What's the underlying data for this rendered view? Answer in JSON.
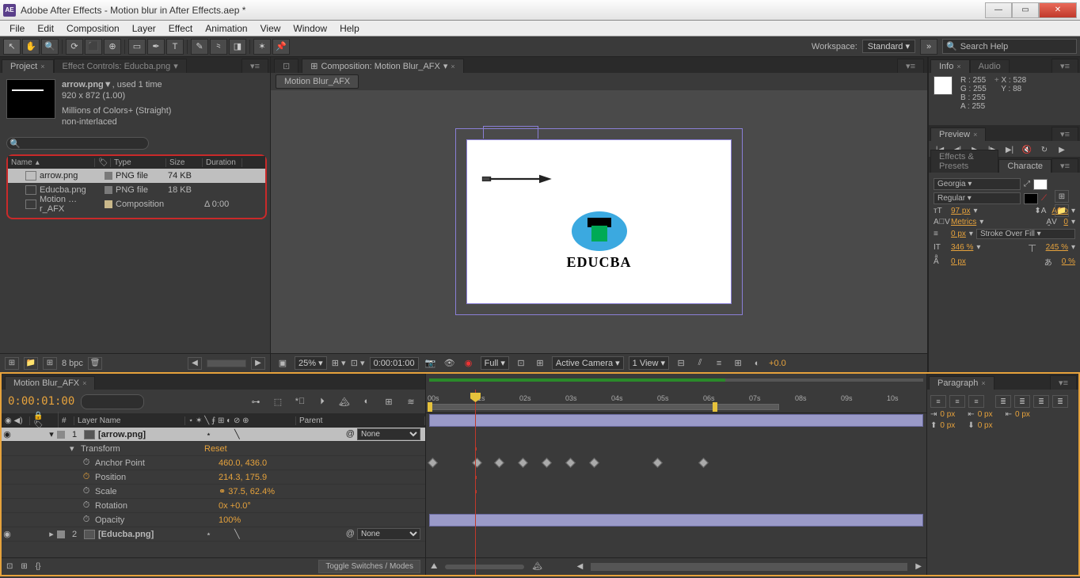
{
  "titlebar": {
    "app_icon": "AE",
    "title": "Adobe After Effects - Motion blur in After Effects.aep *"
  },
  "menubar": [
    "File",
    "Edit",
    "Composition",
    "Layer",
    "Effect",
    "Animation",
    "View",
    "Window",
    "Help"
  ],
  "toolbar": {
    "tools": [
      "⬚",
      "✋",
      "🔍",
      "↻",
      "⬛",
      "⚬",
      "✎",
      "✒",
      "✶",
      "T",
      "✎",
      "⌫",
      "◧",
      "⊞",
      "★",
      "✋"
    ],
    "workspace_label": "Workspace:",
    "workspace_value": "Standard",
    "search_placeholder": "Search Help"
  },
  "project": {
    "tab_label": "Project",
    "effect_controls_tab": "Effect Controls: Educba.png",
    "asset_name": "arrow.png▼",
    "asset_usage": ", used 1 time",
    "asset_dims": "920 x 872 (1.00)",
    "asset_colors": "Millions of Colors+ (Straight)",
    "asset_interlace": "non-interlaced",
    "cols": {
      "name": "Name",
      "label": "",
      "type": "Type",
      "size": "Size",
      "duration": "Duration"
    },
    "items": [
      {
        "name": "arrow.png",
        "type": "PNG file",
        "size": "74 KB",
        "dur": "",
        "selected": true
      },
      {
        "name": "Educba.png",
        "type": "PNG file",
        "size": "18 KB",
        "dur": "",
        "selected": false
      },
      {
        "name": "Motion …r_AFX",
        "type": "Composition",
        "size": "",
        "dur": "Δ 0:00",
        "selected": false
      }
    ],
    "bpc": "8 bpc"
  },
  "composition": {
    "tab_label": "Composition: Motion Blur_AFX",
    "subtab": "Motion Blur_AFX",
    "logo_text": "EDUCBA",
    "footer": {
      "zoom": "25%",
      "timecode": "0:00:01:00",
      "res": "Full",
      "camera": "Active Camera",
      "views": "1 View",
      "exposure": "+0.0"
    }
  },
  "info": {
    "tab_label": "Info",
    "audio_tab": "Audio",
    "r": "R : 255",
    "g": "G : 255",
    "b": "B : 255",
    "a": "A : 255",
    "x": "X : 528",
    "y": "Y : 88"
  },
  "preview": {
    "tab_label": "Preview"
  },
  "effects_presets": {
    "tab_label": "Effects & Presets",
    "char_tab": "Characte"
  },
  "character": {
    "font": "Georgia",
    "style": "Regular",
    "size": "97 px",
    "leading": "Auto",
    "kerning": "Metrics",
    "tracking": "0",
    "stroke_w": "0 px",
    "stroke_style": "Stroke Over Fill",
    "vscale": "346 %",
    "hscale": "245 %",
    "baseline": "0 px",
    "tsume": "0 %"
  },
  "timeline": {
    "tab_label": "Motion Blur_AFX",
    "timecode": "0:00:01:00",
    "cols": {
      "visibility": "",
      "label": "#",
      "layer_name": "Layer Name",
      "switches": "",
      "parent": "Parent"
    },
    "layers": [
      {
        "num": "1",
        "name": "[arrow.png]",
        "parent": "None",
        "selected": true,
        "transform_label": "Transform",
        "reset_label": "Reset",
        "props": [
          {
            "name": "Anchor Point",
            "val": "460.0, 436.0",
            "kf": false
          },
          {
            "name": "Position",
            "val": "214.3, 175.9",
            "kf": true
          },
          {
            "name": "Scale",
            "val": "37.5, 62.4%",
            "kf": false,
            "link": "⚭"
          },
          {
            "name": "Rotation",
            "val": "0x +0.0°",
            "kf": false
          },
          {
            "name": "Opacity",
            "val": "100%",
            "kf": false
          }
        ]
      },
      {
        "num": "2",
        "name": "[Educba.png]",
        "parent": "None",
        "selected": false
      }
    ],
    "ticks": [
      "00s",
      "01s",
      "02s",
      "03s",
      "04s",
      "05s",
      "06s",
      "07s",
      "08s",
      "09s",
      "10s"
    ],
    "kf_positions_pct": [
      0,
      3,
      15,
      20,
      26,
      31,
      36,
      48,
      56
    ],
    "toggle_label": "Toggle Switches / Modes"
  },
  "paragraph": {
    "tab_label": "Paragraph",
    "indent_left": "0 px",
    "indent_right": "0 px",
    "first_line": "0 px",
    "space_before": "0 px",
    "space_after": "0 px"
  }
}
